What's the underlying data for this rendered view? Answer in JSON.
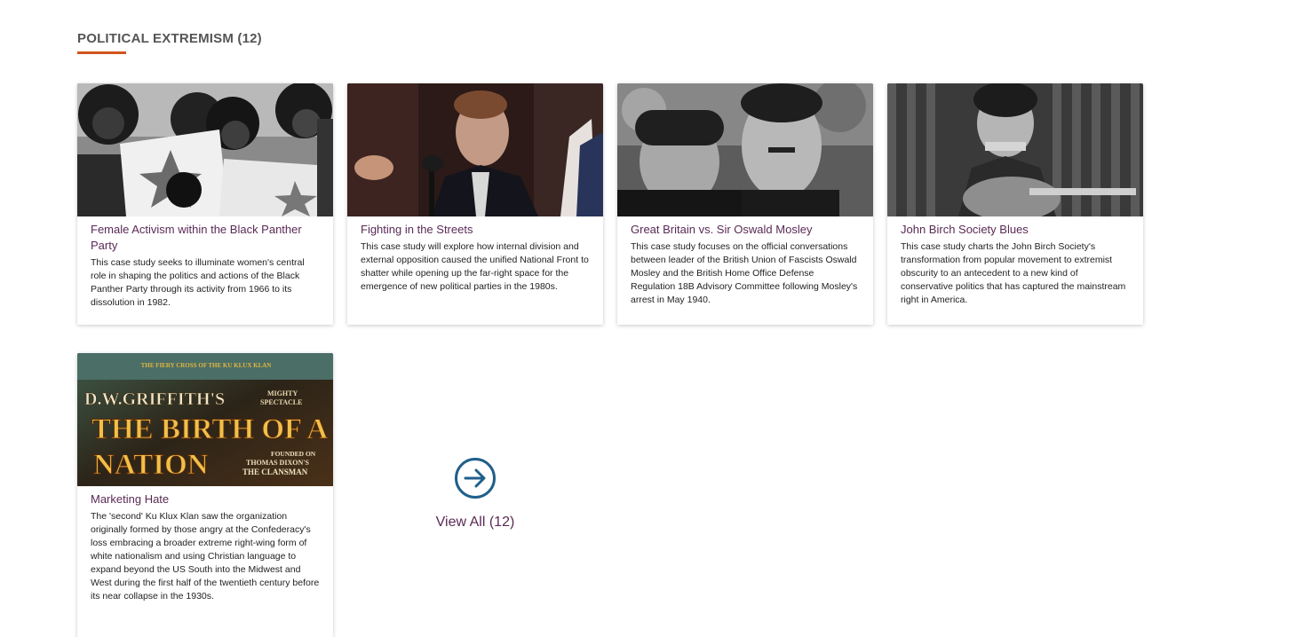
{
  "section": {
    "title": "POLITICAL EXTREMISM (12)",
    "accent_color": "#d2541e",
    "link_color": "#5a2a55"
  },
  "cards": [
    {
      "title": "Female Activism within the Black Panther Party",
      "description": "This case study seeks to illuminate women's central role in shaping the politics and actions of the Black Panther Party through its activity from 1966 to its dissolution in 1982.",
      "image": "black-panther-women-photo"
    },
    {
      "title": "Fighting in the Streets",
      "description": "This case study will explore how internal division and external opposition caused the unified National Front to shatter while opening up the far-right space for the emergence of new political parties in the 1980s.",
      "image": "man-speaking-at-microphone-photo"
    },
    {
      "title": "Great Britain vs. Sir Oswald Mosley",
      "description": "This case study focuses on the official conversations between leader of the British Union of Fascists Oswald Mosley and the British Home Office Defense Regulation 18B Advisory Committee following Mosley's arrest in May 1940.",
      "image": "two-men-portrait-photo"
    },
    {
      "title": "John Birch Society Blues",
      "description": "This case study charts the John Birch Society's transformation from popular movement to extremist obscurity to an antecedent to a new kind of conservative politics that has captured the mainstream right in America.",
      "image": "guitar-harmonica-player-photo"
    },
    {
      "title": "Marketing Hate",
      "description": "The 'second' Ku Klux Klan saw the organization originally formed by those angry at the Confederacy's loss embracing a broader extreme right-wing form of white nationalism and using Christian language to expand beyond the US South into the Midwest and West during the first half of the twentieth century before its near collapse in the 1930s.",
      "image": "birth-of-a-nation-poster",
      "poster_text": {
        "top": "THE FIERY CROSS OF THE KU KLUX KLAN",
        "line1": "D.W.GRIFFITH'S",
        "mighty": "MIGHTY",
        "spectacle": "SPECTACLE",
        "line2": "THE BIRTH OF A",
        "line3": "NATION",
        "founded1": "FOUNDED ON",
        "founded2": "THOMAS DIXON'S",
        "founded3": "THE CLANSMAN"
      }
    }
  ],
  "view_all": {
    "label": "View All (12)",
    "icon": "arrow-right-circle-icon",
    "icon_color": "#1f5f8b"
  }
}
